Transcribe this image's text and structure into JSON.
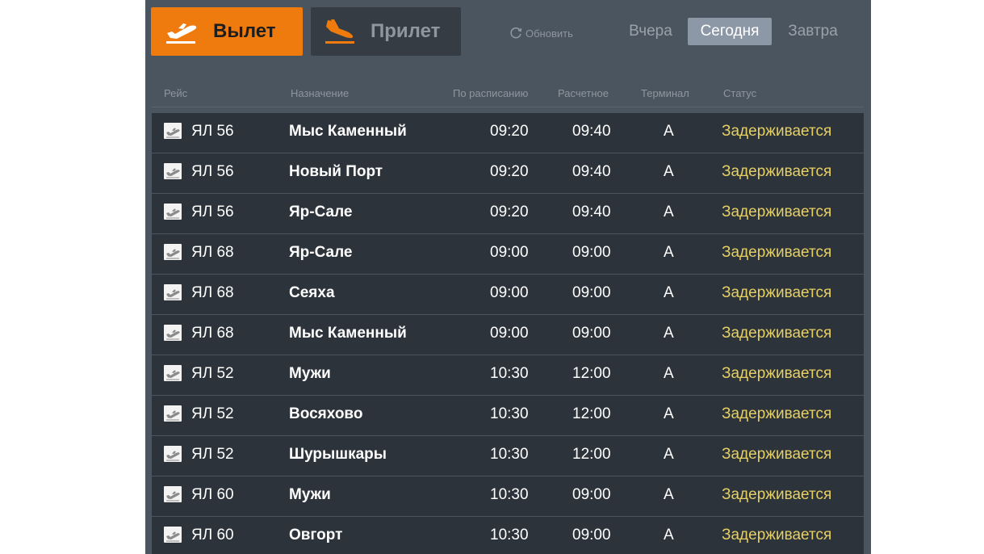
{
  "tabs": {
    "departures": "Вылет",
    "arrivals": "Прилет"
  },
  "refresh": {
    "label": "Обновить",
    "icon": "refresh-icon"
  },
  "days": {
    "yesterday": "Вчера",
    "today": "Сегодня",
    "tomorrow": "Завтра",
    "selected": "today"
  },
  "columns": {
    "flight": "Рейс",
    "destination": "Назначение",
    "scheduled": "По расписанию",
    "estimated": "Расчетное",
    "terminal": "Терминал",
    "status": "Статус"
  },
  "colors": {
    "accent": "#ef7b0e",
    "board_bg": "#4b5560",
    "row_bg": "#2c333a",
    "status_delayed": "#e6cf63"
  },
  "flights": [
    {
      "flight": "ЯЛ 56",
      "destination": "Мыс Каменный",
      "scheduled": "09:20",
      "estimated": "09:40",
      "terminal": "A",
      "status": "Задерживается"
    },
    {
      "flight": "ЯЛ 56",
      "destination": "Новый Порт",
      "scheduled": "09:20",
      "estimated": "09:40",
      "terminal": "A",
      "status": "Задерживается"
    },
    {
      "flight": "ЯЛ 56",
      "destination": "Яр-Сале",
      "scheduled": "09:20",
      "estimated": "09:40",
      "terminal": "A",
      "status": "Задерживается"
    },
    {
      "flight": "ЯЛ 68",
      "destination": "Яр-Сале",
      "scheduled": "09:00",
      "estimated": "09:00",
      "terminal": "A",
      "status": "Задерживается"
    },
    {
      "flight": "ЯЛ 68",
      "destination": "Сеяха",
      "scheduled": "09:00",
      "estimated": "09:00",
      "terminal": "A",
      "status": "Задерживается"
    },
    {
      "flight": "ЯЛ 68",
      "destination": "Мыс Каменный",
      "scheduled": "09:00",
      "estimated": "09:00",
      "terminal": "A",
      "status": "Задерживается"
    },
    {
      "flight": "ЯЛ 52",
      "destination": "Мужи",
      "scheduled": "10:30",
      "estimated": "12:00",
      "terminal": "A",
      "status": "Задерживается"
    },
    {
      "flight": "ЯЛ 52",
      "destination": "Восяхово",
      "scheduled": "10:30",
      "estimated": "12:00",
      "terminal": "A",
      "status": "Задерживается"
    },
    {
      "flight": "ЯЛ 52",
      "destination": "Шурышкары",
      "scheduled": "10:30",
      "estimated": "12:00",
      "terminal": "A",
      "status": "Задерживается"
    },
    {
      "flight": "ЯЛ 60",
      "destination": "Мужи",
      "scheduled": "10:30",
      "estimated": "09:00",
      "terminal": "A",
      "status": "Задерживается"
    },
    {
      "flight": "ЯЛ 60",
      "destination": "Овгорт",
      "scheduled": "10:30",
      "estimated": "09:00",
      "terminal": "A",
      "status": "Задерживается"
    }
  ]
}
